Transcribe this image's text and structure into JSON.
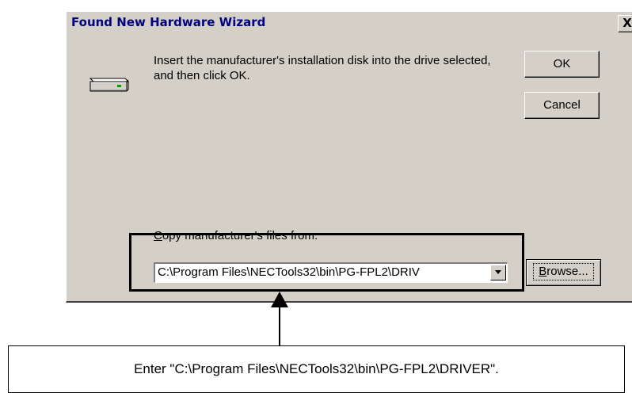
{
  "dialog": {
    "title": "Found New Hardware Wizard",
    "close_glyph": "X",
    "message": "Insert the manufacturer's installation disk into the drive selected, and then click OK.",
    "ok_label": "OK",
    "cancel_label": "Cancel",
    "copy_label_first": "C",
    "copy_label_rest": "opy manufacturer's files from:",
    "path_value": "C:\\Program Files\\NECTools32\\bin\\PG-FPL2\\DRIV",
    "browse_label_first": "B",
    "browse_label_rest": "rowse...",
    "icon": "drive-icon"
  },
  "callout": {
    "text": "Enter \"C:\\Program Files\\NECTools32\\bin\\PG-FPL2\\DRIVER\"."
  },
  "colors": {
    "dialog_face": "#d4d0c8",
    "title_text": "#000080",
    "highlight_border": "#000000"
  }
}
